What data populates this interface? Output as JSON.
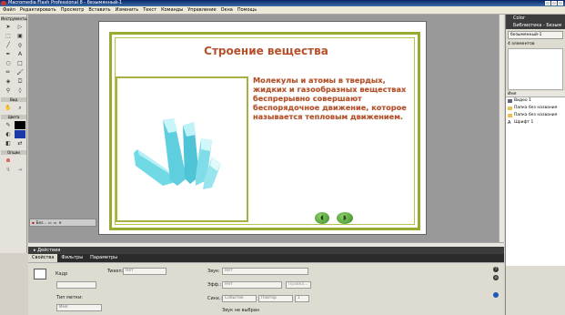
{
  "window": {
    "title": "Macromedia Flash Professional 8 - безымянный-1"
  },
  "menu": [
    "Файл",
    "Редактировать",
    "Просмотр",
    "Вставить",
    "Изменить",
    "Текст",
    "Команды",
    "Управление",
    "Окна",
    "Помощь"
  ],
  "tools": {
    "label": "Инструменты",
    "view_label": "Вид",
    "colors_label": "Цвета",
    "options_label": "Опции"
  },
  "slide": {
    "title": "Строение вещества",
    "text": "Молекулы и атомы в твердых, жидких и газообразных веществах беспрерывно совершают беспорядочное движение, которое называется тепловым движением."
  },
  "doc_tab": {
    "label": "Без..."
  },
  "panels": {
    "actions": "Действия",
    "tabs": [
      "Свойства",
      "Фильтры",
      "Параметры"
    ]
  },
  "props": {
    "frame_label": "Кадр",
    "tween_label": "Tween:",
    "tween_value": "Нет",
    "label_type": "Тип метки:",
    "label_type_value": "Имя",
    "sound_label": "Звук:",
    "sound_value": "Нет",
    "effect_label": "Эфф.:",
    "effect_value": "Нет",
    "edit_button": "Правка...",
    "sync_label": "Синх.:",
    "sync_value": "Событие",
    "repeat_value": "Повтор",
    "repeat_count": "1",
    "sound_status": "Звук не выбран"
  },
  "right_panel": {
    "color": "Color",
    "library": "Библиотека - Безым",
    "doc": "безымянный-1",
    "count": "4 элементов",
    "name_col": "Имя",
    "items": [
      {
        "label": "Видео 1",
        "icon": "video-icon"
      },
      {
        "label": "Папка без названия",
        "icon": "folder-icon"
      },
      {
        "label": "Папка без названия",
        "icon": "folder-icon"
      },
      {
        "label": "Шрифт 1",
        "icon": "font-icon"
      }
    ]
  }
}
